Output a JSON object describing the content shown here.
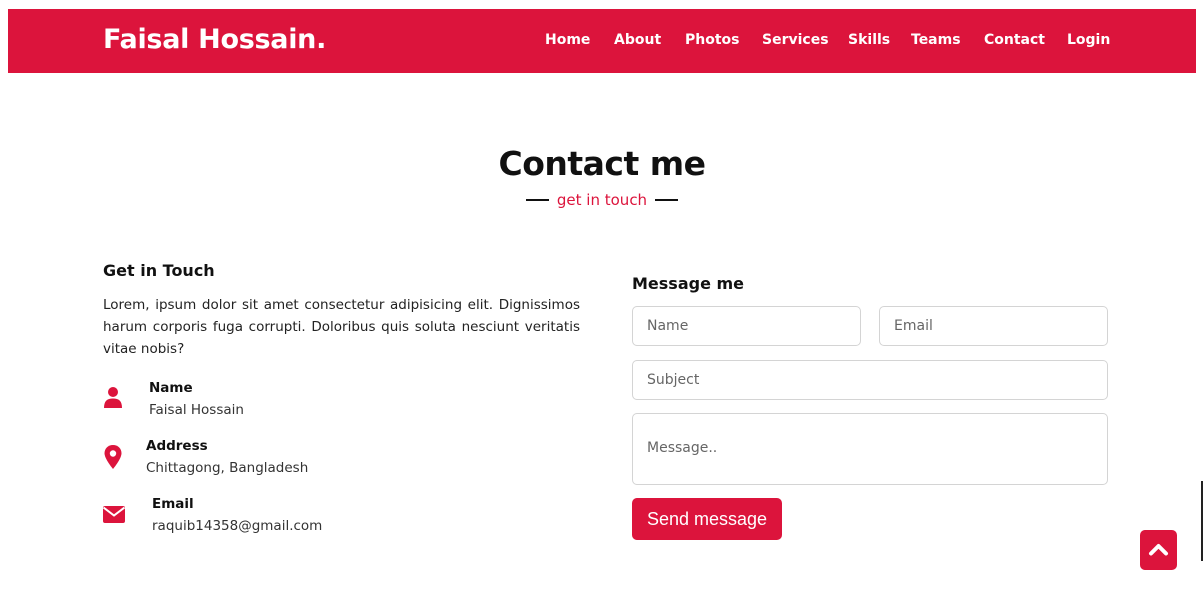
{
  "navbar": {
    "brand": "Faisal Hossain.",
    "links": [
      "Home",
      "About",
      "Photos",
      "Services",
      "Skills",
      "Teams",
      "Contact",
      "Login"
    ]
  },
  "section": {
    "title": "Contact me",
    "subtitle": "get in touch"
  },
  "left": {
    "heading": "Get in Touch",
    "text": "Lorem, ipsum dolor sit amet consectetur adipisicing elit. Dignissimos harum corporis fuga corrupti. Doloribus quis soluta nesciunt veritatis vitae nobis?",
    "info": [
      {
        "icon": "user-icon",
        "title": "Name",
        "value": "Faisal Hossain"
      },
      {
        "icon": "map-marker-icon",
        "title": "Address",
        "value": "Chittagong, Bangladesh"
      },
      {
        "icon": "envelope-icon",
        "title": "Email",
        "value": "raquib14358@gmail.com"
      }
    ]
  },
  "right": {
    "heading": "Message me",
    "placeholders": {
      "name": "Name",
      "email": "Email",
      "subject": "Subject",
      "message": "Message.."
    },
    "send_label": "Send message"
  },
  "scroll_up": {
    "icon": "chevron-up-icon"
  },
  "colors": {
    "accent": "#dc143c",
    "text": "#111111"
  }
}
